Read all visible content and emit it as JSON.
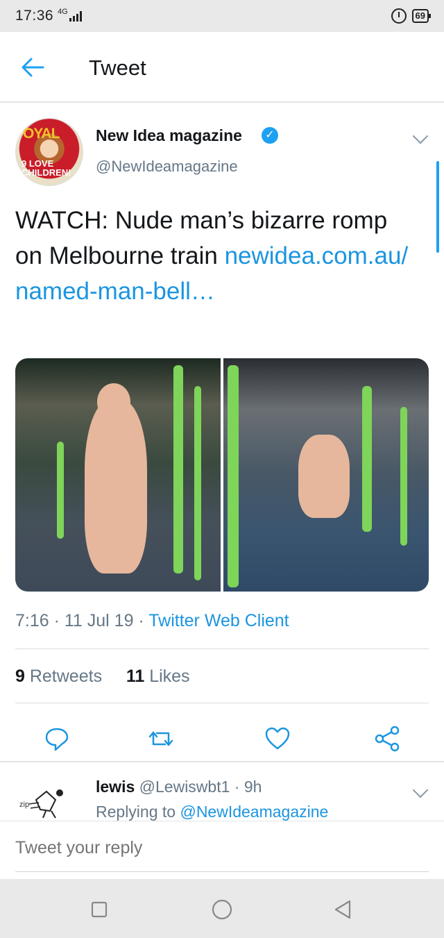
{
  "status_bar": {
    "time": "17:36",
    "network": "4G",
    "battery": "69"
  },
  "header": {
    "title": "Tweet",
    "back_icon": "arrow-left-icon"
  },
  "tweet": {
    "author": {
      "display_name": "New Idea magazine",
      "handle": "@NewIdeamagazine",
      "verified": true,
      "avatar_text_top": "OYAL",
      "avatar_text_mid": "9 LOVE CHILDREN!"
    },
    "text": "WATCH: Nude man’s bizarre romp on Melbourne train ",
    "link": "newidea.com.au/ named-man-bell…",
    "timestamp": "7:16 · 11 Jul 19 · ",
    "client": "Twitter Web Client",
    "retweets_count": "9",
    "retweets_label": " Retweets",
    "likes_count": "11",
    "likes_label": " Likes"
  },
  "actions": {
    "reply": "reply-icon",
    "retweet": "retweet-icon",
    "like": "heart-icon",
    "share": "share-icon"
  },
  "reply": {
    "name": "lewis",
    "handle_time": " @Lewiswbt1 · 9h",
    "replying_prefix": "Replying to ",
    "replying_handle": "@NewIdeamagazine"
  },
  "compose": {
    "placeholder": "Tweet your reply"
  },
  "colors": {
    "accent": "#1da1f2",
    "link": "#1b95e0",
    "secondary_text": "#657786"
  }
}
